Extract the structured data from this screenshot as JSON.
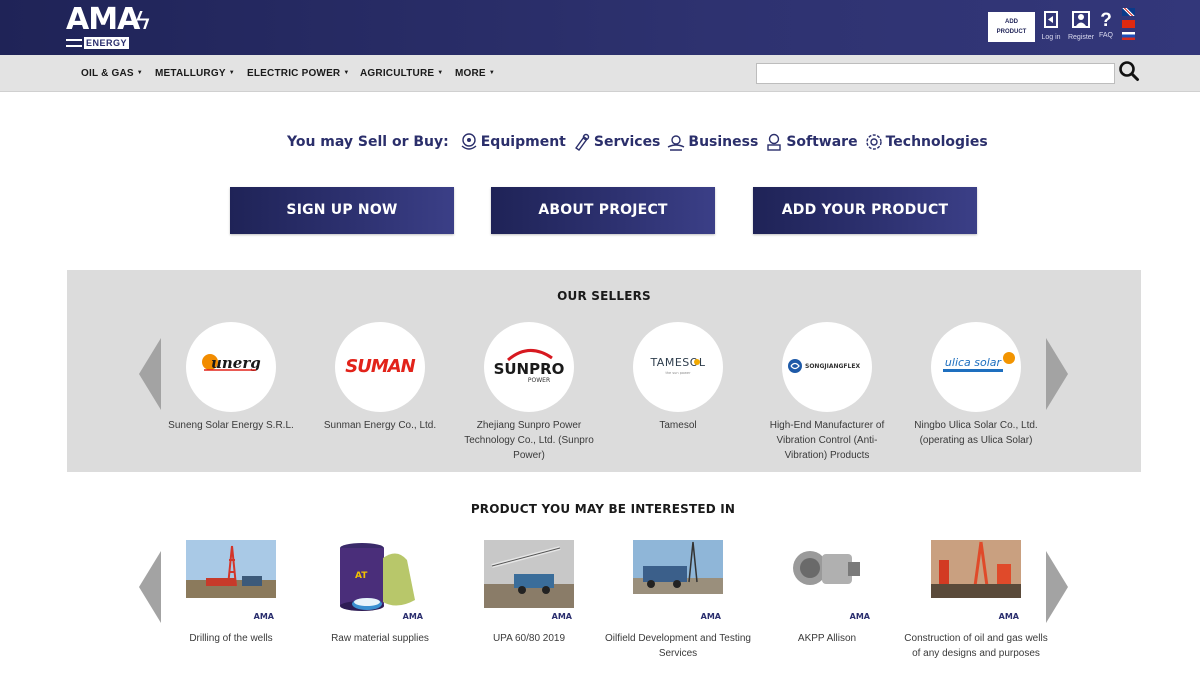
{
  "header": {
    "logo_text": "AMA",
    "logo_sub": "ENERGY",
    "add_product_line1": "ADD",
    "add_product_line2": "PRODUCT",
    "login_label": "Log in",
    "register_label": "Register",
    "faq_label": "FAQ",
    "languages": [
      "en",
      "cn",
      "ru"
    ]
  },
  "nav": {
    "items": [
      "OIL & GAS",
      "METALLURGY",
      "ELECTRIC POWER",
      "AGRICULTURE",
      "MORE"
    ],
    "search_placeholder": ""
  },
  "tagline": {
    "lead": "You may Sell or Buy:",
    "categories": [
      {
        "label": "Equipment",
        "icon": "equipment-icon"
      },
      {
        "label": "Services",
        "icon": "services-icon"
      },
      {
        "label": "Business",
        "icon": "business-icon"
      },
      {
        "label": "Software",
        "icon": "software-icon"
      },
      {
        "label": "Technologies",
        "icon": "technologies-icon"
      }
    ]
  },
  "cta": {
    "signup": "SIGN UP NOW",
    "about": "ABOUT PROJECT",
    "add_product": "ADD YOUR PRODUCT"
  },
  "sellers": {
    "title": "OUR SELLERS",
    "items": [
      {
        "name": "Suneng Solar Energy S.R.L.",
        "logo_text": "Sunerg",
        "logo_color": "#1a1a1a",
        "accent": "#f28c00"
      },
      {
        "name": "Sunman Energy Co., Ltd.",
        "logo_text": "SUMAN",
        "logo_color": "#e2231a",
        "accent": "#e2231a"
      },
      {
        "name": "Zhejiang Sunpro Power Technology Co., Ltd. (Sunpro Power)",
        "logo_text": "SUNPRO",
        "logo_sub": "POWER",
        "logo_color": "#1a1a1a",
        "accent": "#d71920"
      },
      {
        "name": "Tamesol",
        "logo_text": "TAMESOL",
        "logo_color": "#2f3e4d",
        "accent": "#f2a900"
      },
      {
        "name": "High-End Manufacturer of Vibration Control (Anti-Vibration) Products",
        "logo_text": "SONGJIANGFLEX",
        "logo_color": "#333333",
        "accent": "#1e5aa8"
      },
      {
        "name": "Ningbo Ulica Solar Co., Ltd. (operating as Ulica Solar)",
        "logo_text": "ulica solar",
        "logo_color": "#1e6fbf",
        "accent": "#f29400"
      }
    ]
  },
  "products": {
    "title": "PRODUCT YOU MAY BE INTERESTED IN",
    "badge": "AMA",
    "items": [
      {
        "name": "Drilling of the wells"
      },
      {
        "name": "Raw material supplies"
      },
      {
        "name": "UPA 60/80 2019"
      },
      {
        "name": "Oilfield Development and Testing Services"
      },
      {
        "name": "AKPP Allison"
      },
      {
        "name": "Construction of oil and gas wells of any designs and purposes"
      }
    ]
  },
  "colors": {
    "brand_navy": "#2b2f6b",
    "header_bg": "#2e3270",
    "nav_bg": "#e3e3e3",
    "panel_bg": "#dcdcdc",
    "arrow": "#a3a3a3"
  }
}
